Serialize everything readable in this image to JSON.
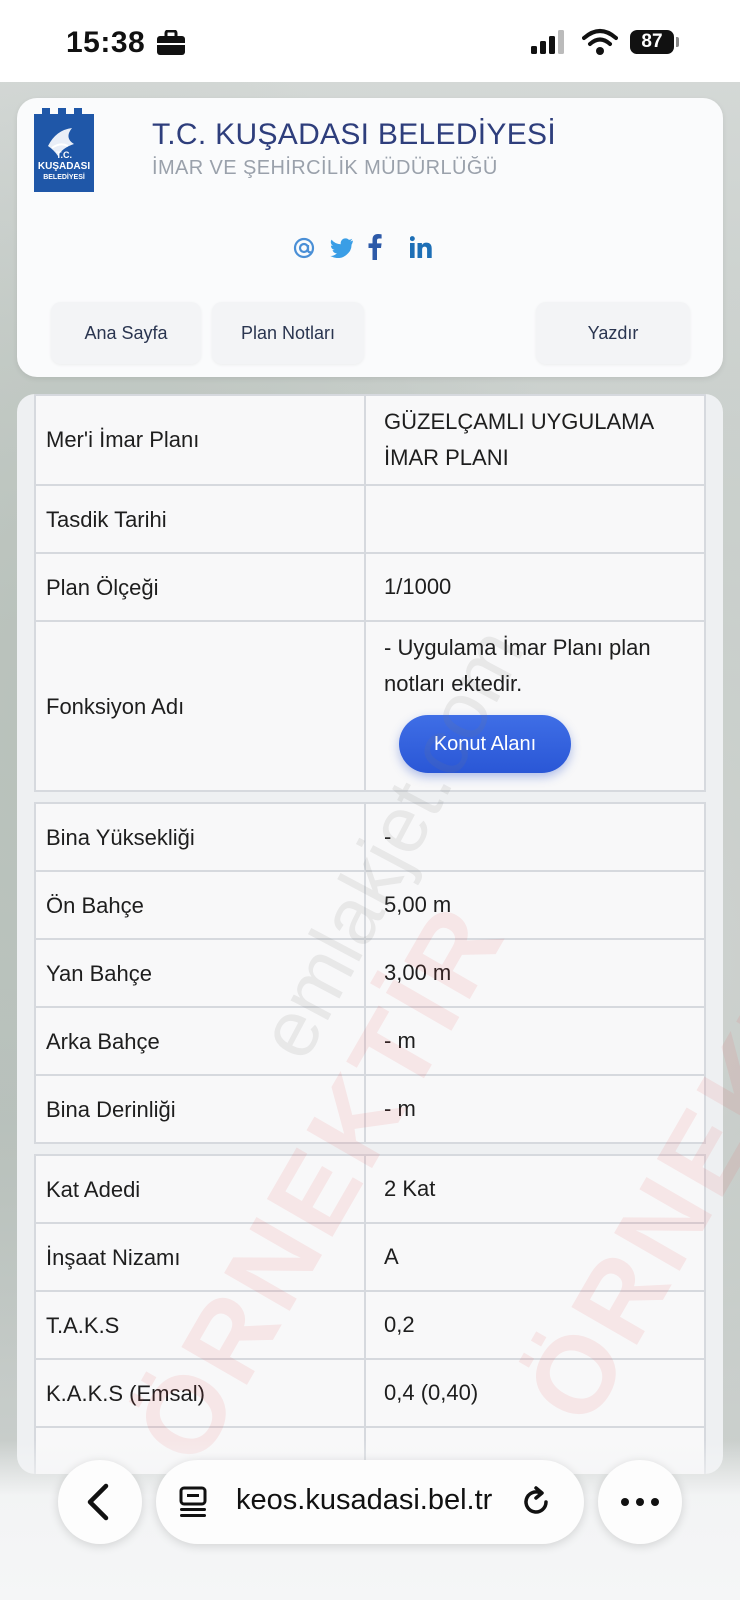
{
  "status_bar": {
    "time": "15:38",
    "battery": "87"
  },
  "header": {
    "logo_text": [
      "T.C.",
      "KUŞADASI",
      "BELEDİYESİ"
    ],
    "org_name": "T.C. KUŞADASI BELEDİYESİ",
    "org_sub": "İMAR VE ŞEHİRCİLİK MÜDÜRLÜĞÜ",
    "social_icons": [
      "at-icon",
      "twitter-icon",
      "facebook-icon",
      "linkedin-icon"
    ],
    "nav": {
      "home": "Ana Sayfa",
      "plan_notes": "Plan Notları",
      "print": "Yazdır"
    }
  },
  "table": {
    "rows": [
      {
        "label": "Mer'i İmar Planı",
        "value_lines": [
          "GÜZELÇAMLI UYGULAMA",
          "İMAR PLANI"
        ]
      },
      {
        "label": "Tasdik Tarihi",
        "value": ""
      },
      {
        "label": "Plan Ölçeği",
        "value": "1/1000"
      },
      {
        "label": "Fonksiyon Adı",
        "value_lines": [
          "- Uygulama İmar Planı plan",
          "notları ektedir."
        ],
        "button": "Konut Alanı"
      },
      {
        "label": "Bina Yüksekliği",
        "value": "-"
      },
      {
        "label": "Ön Bahçe",
        "value": "5,00 m"
      },
      {
        "label": "Yan Bahçe",
        "value": "3,00 m"
      },
      {
        "label": "Arka Bahçe",
        "value": "- m"
      },
      {
        "label": "Bina Derinliği",
        "value": "- m"
      },
      {
        "label": "Kat Adedi",
        "value": "2 Kat"
      },
      {
        "label": "İnşaat Nizamı",
        "value": "A"
      },
      {
        "label": "T.A.K.S",
        "value": "0,2"
      },
      {
        "label": "K.A.K.S (Emsal)",
        "value": "0,4 (0,40)"
      }
    ]
  },
  "watermarks": {
    "main": "ÖRNEKTİR",
    "site": "emlakjet.com"
  },
  "browser": {
    "url": "keos.kusadasi.bel.tr"
  },
  "colors": {
    "brand_blue": "#2e3e7c",
    "button_blue": "#2a57d6"
  }
}
